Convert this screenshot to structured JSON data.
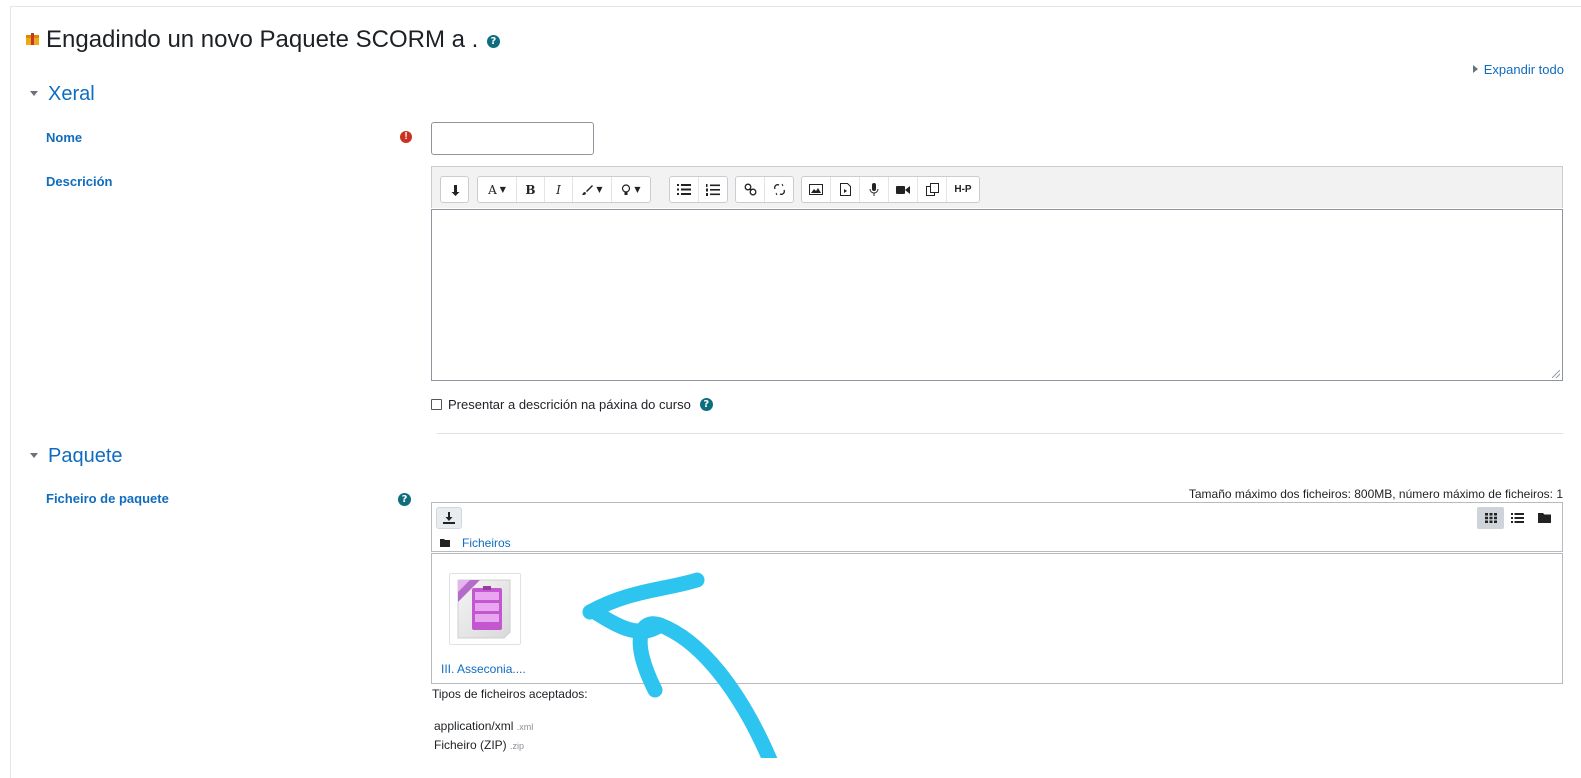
{
  "page": {
    "title": "Engadindo un novo Paquete SCORM a .",
    "expand_all": "Expandir todo"
  },
  "general": {
    "heading": "Xeral",
    "name_label": "Nome",
    "name_value": "",
    "description_label": "Descrición",
    "show_description_label": "Presentar a descrición na páxina do curso",
    "show_description_checked": false
  },
  "toolbar": {
    "groups": [
      [
        "collapse-icon"
      ],
      [
        "font-size-icon",
        "bold-icon",
        "italic-icon",
        "text-color-icon",
        "lightbulb-icon"
      ],
      [
        "bullet-list-icon",
        "numbered-list-icon"
      ],
      [
        "link-icon",
        "unlink-icon"
      ],
      [
        "image-icon",
        "media-icon",
        "microphone-icon",
        "video-icon",
        "manage-files-icon",
        "h5p-icon"
      ]
    ],
    "h5p_label": "H-P"
  },
  "package": {
    "heading": "Paquete",
    "file_label": "Ficheiro de paquete",
    "max_size": "Tamaño máximo dos ficheiros: 800MB, número máximo de ficheiros: 1",
    "folder_label": "Ficheiros",
    "file_name": "III. Asseconia....",
    "accepted_types_label": "Tipos de ficheiros aceptados:",
    "accepted_types": [
      {
        "name": "application/xml",
        "ext": ".xml"
      },
      {
        "name": "Ficheiro (ZIP)",
        "ext": ".zip"
      }
    ],
    "view_modes": [
      "grid-view-icon",
      "list-view-icon",
      "tree-view-icon"
    ],
    "active_view": "grid-view-icon"
  },
  "colors": {
    "link": "#0f6cbf",
    "required": "#ca3120",
    "help": "#0f6e7e",
    "annotation_arrow": "#2ec4f0"
  }
}
